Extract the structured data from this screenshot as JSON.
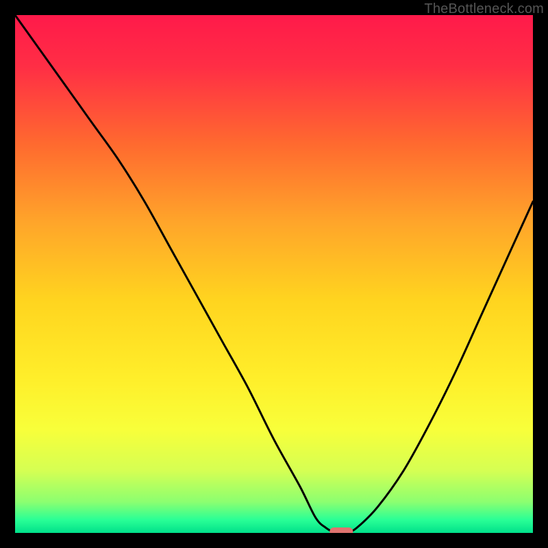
{
  "watermark": "TheBottleneck.com",
  "colors": {
    "frame_bg": "#000000",
    "line": "#000000",
    "marker_fill": "#e0736f",
    "gradient_stops": [
      {
        "offset": 0.0,
        "color": "#ff1a4a"
      },
      {
        "offset": 0.1,
        "color": "#ff2e45"
      },
      {
        "offset": 0.25,
        "color": "#ff6a2f"
      },
      {
        "offset": 0.4,
        "color": "#ffa52a"
      },
      {
        "offset": 0.55,
        "color": "#ffd41f"
      },
      {
        "offset": 0.7,
        "color": "#ffee2a"
      },
      {
        "offset": 0.8,
        "color": "#f8ff3a"
      },
      {
        "offset": 0.88,
        "color": "#d5ff53"
      },
      {
        "offset": 0.94,
        "color": "#8cff70"
      },
      {
        "offset": 0.975,
        "color": "#29ff96"
      },
      {
        "offset": 1.0,
        "color": "#00e08a"
      }
    ]
  },
  "chart_data": {
    "type": "line",
    "title": "",
    "xlabel": "",
    "ylabel": "",
    "xlim": [
      0,
      100
    ],
    "ylim": [
      0,
      100
    ],
    "x": [
      0,
      5,
      10,
      15,
      20,
      25,
      30,
      35,
      40,
      45,
      50,
      55,
      58,
      60,
      62,
      64,
      66,
      70,
      75,
      80,
      85,
      90,
      95,
      100
    ],
    "values": [
      100,
      93,
      86,
      79,
      72,
      64,
      55,
      46,
      37,
      28,
      18,
      9,
      3,
      1,
      0,
      0,
      1,
      5,
      12,
      21,
      31,
      42,
      53,
      64
    ],
    "minimum_marker": {
      "x": 63,
      "y": 0
    }
  }
}
